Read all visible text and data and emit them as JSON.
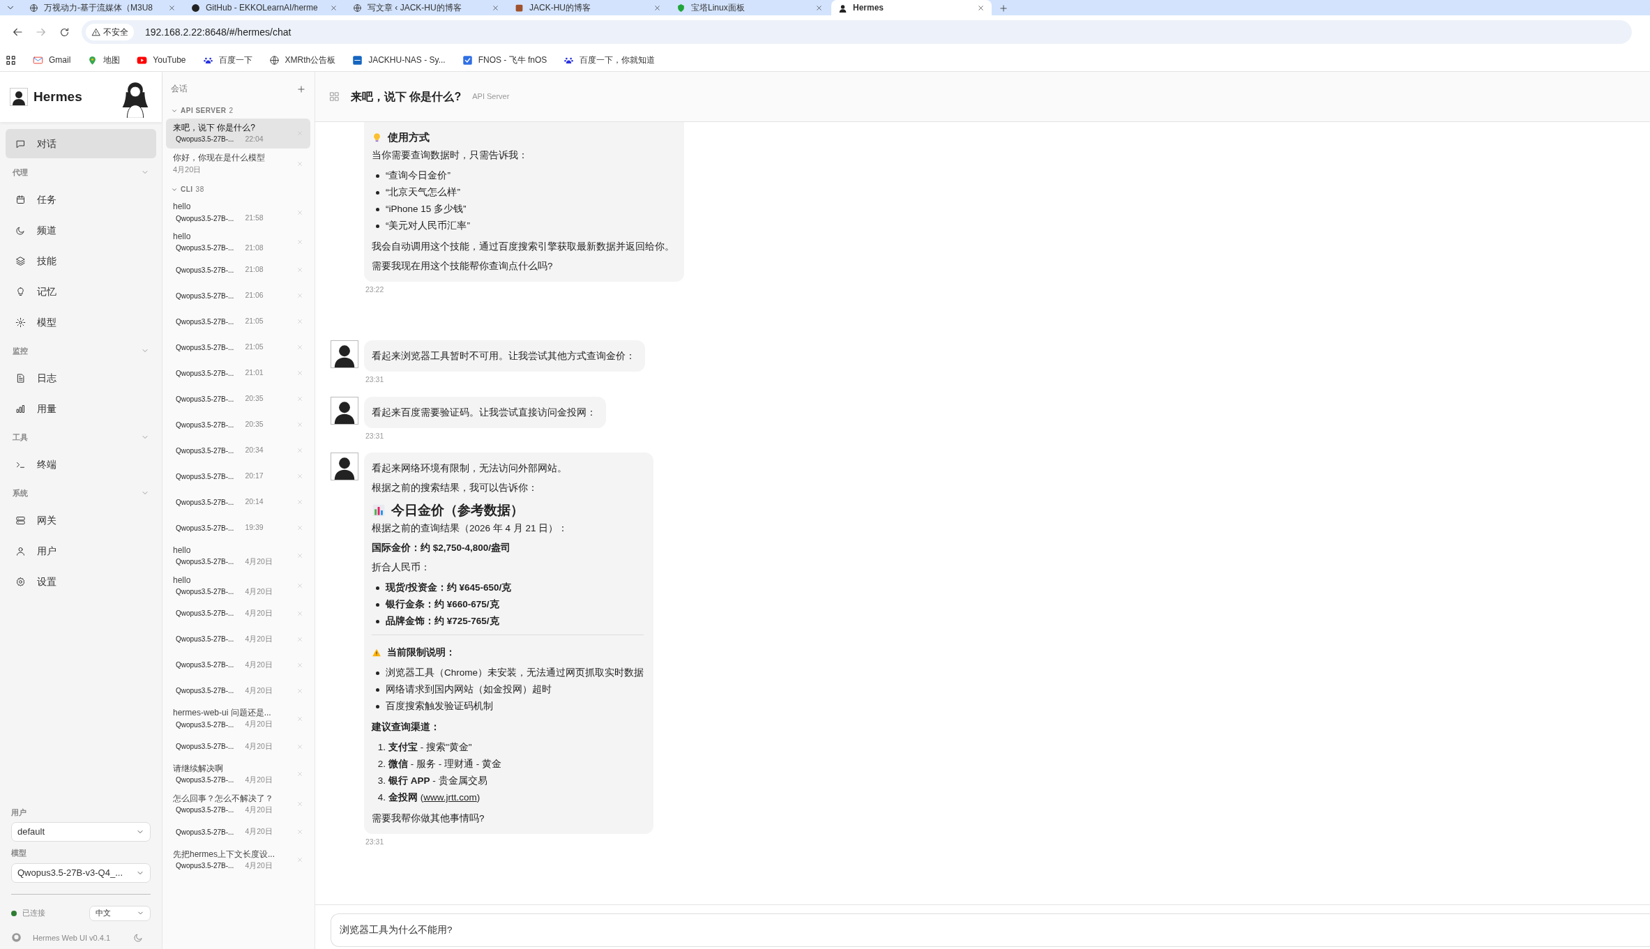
{
  "browser": {
    "tabs": [
      {
        "title": "万视动力-基于流媒体（M3U8",
        "selected": false
      },
      {
        "title": "GitHub - EKKOLearnAI/herme",
        "selected": false
      },
      {
        "title": "写文章 ‹ JACK-HU的博客",
        "selected": false
      },
      {
        "title": "JACK-HU的博客",
        "selected": false
      },
      {
        "title": "宝塔Linux面板",
        "selected": false
      },
      {
        "title": "Hermes",
        "selected": true
      }
    ],
    "security_label": "不安全",
    "url": "192.168.2.22:8648/#/hermes/chat",
    "bookmarks": [
      "Gmail",
      "地图",
      "YouTube",
      "百度一下",
      "XMRth公告板",
      "JACKHU-NAS - Sy...",
      "FNOS - 飞牛 fnOS",
      "百度一下，你就知道"
    ]
  },
  "sidebar": {
    "brand": "Hermes",
    "nav": [
      {
        "kind": "item",
        "label": "对话",
        "selected": true
      },
      {
        "kind": "section",
        "label": "代理"
      },
      {
        "kind": "item",
        "label": "任务",
        "selected": false
      },
      {
        "kind": "item",
        "label": "频道",
        "selected": false
      },
      {
        "kind": "item",
        "label": "技能",
        "selected": false
      },
      {
        "kind": "item",
        "label": "记忆",
        "selected": false
      },
      {
        "kind": "item",
        "label": "模型",
        "selected": false
      },
      {
        "kind": "section",
        "label": "监控"
      },
      {
        "kind": "item",
        "label": "日志",
        "selected": false
      },
      {
        "kind": "item",
        "label": "用量",
        "selected": false
      },
      {
        "kind": "section",
        "label": "工具"
      },
      {
        "kind": "item",
        "label": "终端",
        "selected": false
      },
      {
        "kind": "section",
        "label": "系统"
      },
      {
        "kind": "item",
        "label": "网关",
        "selected": false
      },
      {
        "kind": "item",
        "label": "用户",
        "selected": false
      },
      {
        "kind": "item",
        "label": "设置",
        "selected": false
      }
    ],
    "user_label": "用户",
    "user_value": "default",
    "model_label": "模型",
    "model_value": "Qwopus3.5-27B-v3-Q4_...",
    "connection": {
      "label": "已连接",
      "connected": true
    },
    "language": "中文",
    "version": "Hermes Web UI v0.4.1"
  },
  "sessions": {
    "title": "会话",
    "groups": [
      {
        "name": "API SERVER",
        "count": "2",
        "expanded": true,
        "items": [
          {
            "title": "来吧，说下 你是什么?",
            "model": "Qwopus3.5-27B-...",
            "time": "22:04",
            "selected": true
          },
          {
            "title": "你好，你现在是什么模型",
            "time": "4月20日",
            "selected": false
          }
        ]
      },
      {
        "name": "CLI",
        "count": "38",
        "expanded": true,
        "items": [
          {
            "title": "hello",
            "model": "Qwopus3.5-27B-...",
            "time": "21:58",
            "selected": false
          },
          {
            "title": "hello",
            "model": "Qwopus3.5-27B-...",
            "time": "21:08",
            "selected": false
          },
          {
            "model": "Qwopus3.5-27B-...",
            "time": "21:08",
            "selected": false
          },
          {
            "model": "Qwopus3.5-27B-...",
            "time": "21:06",
            "selected": false
          },
          {
            "model": "Qwopus3.5-27B-...",
            "time": "21:05",
            "selected": false
          },
          {
            "model": "Qwopus3.5-27B-...",
            "time": "21:05",
            "selected": false
          },
          {
            "model": "Qwopus3.5-27B-...",
            "time": "21:01",
            "selected": false
          },
          {
            "model": "Qwopus3.5-27B-...",
            "time": "20:35",
            "selected": false
          },
          {
            "model": "Qwopus3.5-27B-...",
            "time": "20:35",
            "selected": false
          },
          {
            "model": "Qwopus3.5-27B-...",
            "time": "20:34",
            "selected": false
          },
          {
            "model": "Qwopus3.5-27B-...",
            "time": "20:17",
            "selected": false
          },
          {
            "model": "Qwopus3.5-27B-...",
            "time": "20:14",
            "selected": false
          },
          {
            "model": "Qwopus3.5-27B-...",
            "time": "19:39",
            "selected": false
          },
          {
            "title": "hello",
            "model": "Qwopus3.5-27B-...",
            "time": "4月20日",
            "selected": false
          },
          {
            "title": "hello",
            "model": "Qwopus3.5-27B-...",
            "time": "4月20日",
            "selected": false
          },
          {
            "model": "Qwopus3.5-27B-...",
            "time": "4月20日",
            "selected": false
          },
          {
            "model": "Qwopus3.5-27B-...",
            "time": "4月20日",
            "selected": false
          },
          {
            "model": "Qwopus3.5-27B-...",
            "time": "4月20日",
            "selected": false
          },
          {
            "model": "Qwopus3.5-27B-...",
            "time": "4月20日",
            "selected": false
          },
          {
            "title": "hermes-web-ui 问题还是...",
            "model": "Qwopus3.5-27B-...",
            "time": "4月20日",
            "selected": false
          },
          {
            "model": "Qwopus3.5-27B-...",
            "time": "4月20日",
            "selected": false
          },
          {
            "title": "请继续解决啊",
            "model": "Qwopus3.5-27B-...",
            "time": "4月20日",
            "selected": false
          },
          {
            "title": "怎么回事？怎么不解决了？",
            "model": "Qwopus3.5-27B-...",
            "time": "4月20日",
            "selected": false
          },
          {
            "model": "Qwopus3.5-27B-...",
            "time": "4月20日",
            "selected": false
          },
          {
            "title": "先把hermes上下文长度设...",
            "model": "Qwopus3.5-27B-...",
            "time": "4月20日",
            "selected": false
          }
        ]
      }
    ]
  },
  "chat": {
    "title": "来吧，说下 你是什么?",
    "source": "API Server",
    "messages": [
      {
        "avatar": false,
        "time": "23:22",
        "blocks": [
          {
            "kind": "tip-heading",
            "text": "使用方式"
          },
          {
            "kind": "paragraph",
            "text": "当你需要查询数据时，只需告诉我："
          },
          {
            "kind": "bullets",
            "bold": false,
            "items": [
              "“查询今日金价”",
              "“北京天气怎么样”",
              "“iPhone 15 多少钱”",
              "“美元对人民币汇率”"
            ]
          },
          {
            "kind": "paragraph",
            "text": "我会自动调用这个技能，通过百度搜索引擎获取最新数据并返回给你。"
          },
          {
            "kind": "paragraph",
            "text": "需要我现在用这个技能帮你查询点什么吗?"
          }
        ]
      },
      {
        "avatar": true,
        "time": "23:31",
        "blocks": [
          {
            "kind": "paragraph",
            "text": "看起来浏览器工具暂时不可用。让我尝试其他方式查询金价："
          }
        ]
      },
      {
        "avatar": true,
        "time": "23:31",
        "blocks": [
          {
            "kind": "paragraph",
            "text": "看起来百度需要验证码。让我尝试直接访问金投网："
          }
        ]
      },
      {
        "avatar": true,
        "time": "23:31",
        "blocks": [
          {
            "kind": "paragraph",
            "text": "看起来网络环境有限制，无法访问外部网站。"
          },
          {
            "kind": "paragraph",
            "text": "根据之前的搜索结果，我可以告诉你："
          },
          {
            "kind": "chart-heading",
            "text": "今日金价（参考数据）"
          },
          {
            "kind": "paragraph",
            "text": "根据之前的查询结果（2026 年 4 月 21 日）："
          },
          {
            "kind": "strong",
            "text": "国际金价：约 $2,750-4,800/盎司"
          },
          {
            "kind": "paragraph",
            "text": "折合人民币："
          },
          {
            "kind": "bullets",
            "bold": true,
            "items": [
              "现货/投资金：约 ¥645-650/克",
              "银行金条：约 ¥660-675/克",
              "品牌金饰：约 ¥725-765/克"
            ]
          },
          {
            "kind": "rule"
          },
          {
            "kind": "warning",
            "text": "当前限制说明："
          },
          {
            "kind": "bullets",
            "bold": false,
            "items": [
              "浏览器工具（Chrome）未安装，无法通过网页抓取实时数据",
              "网络请求到国内网站（如金投网）超时",
              "百度搜索触发验证码机制"
            ]
          },
          {
            "kind": "strong",
            "text": "建议查询渠道："
          },
          {
            "kind": "numbered",
            "items": [
              {
                "number": "1.",
                "text": "**支付宝** - 搜索\"黄金\""
              },
              {
                "number": "2.",
                "text": "**微信** - 服务 - 理财通 - 黄金"
              },
              {
                "number": "3.",
                "text": "**银行 APP** - 贵金属交易"
              },
              {
                "number": "4.",
                "text": "**金投网** (",
                "link": "www.jrtt.com",
                "tail": ")"
              }
            ]
          },
          {
            "kind": "paragraph",
            "text": "需要我帮你做其他事情吗?"
          }
        ]
      }
    ],
    "input_value": "浏览器工具为什么不能用?"
  }
}
